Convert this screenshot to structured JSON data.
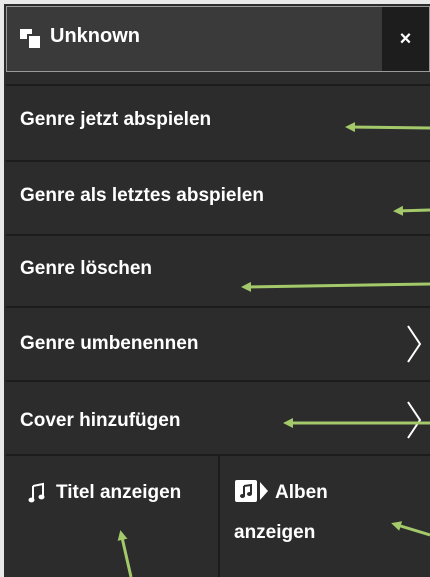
{
  "dialog": {
    "title": "Unknown",
    "close_label": "×"
  },
  "menu": [
    {
      "label": "Genre jetzt abspielen",
      "has_submenu": false
    },
    {
      "label": "Genre als letztes abspielen",
      "has_submenu": false
    },
    {
      "label": "Genre löschen",
      "has_submenu": false
    },
    {
      "label": "Genre umbenennen",
      "has_submenu": true
    },
    {
      "label": "Cover hinzufügen",
      "has_submenu": true
    }
  ],
  "actions": {
    "show_titles": {
      "label": "Titel anzeigen",
      "icon": "music-note-icon"
    },
    "show_albums": {
      "label_line1": "Alben",
      "label_line2": "anzeigen",
      "icon": "album-icon"
    }
  },
  "colors": {
    "background": "#2c2c2c",
    "divider": "#1c1c1c",
    "close_background": "#1d1d1d",
    "text": "#ffffff",
    "annotation_arrow": "#a3c96a"
  }
}
